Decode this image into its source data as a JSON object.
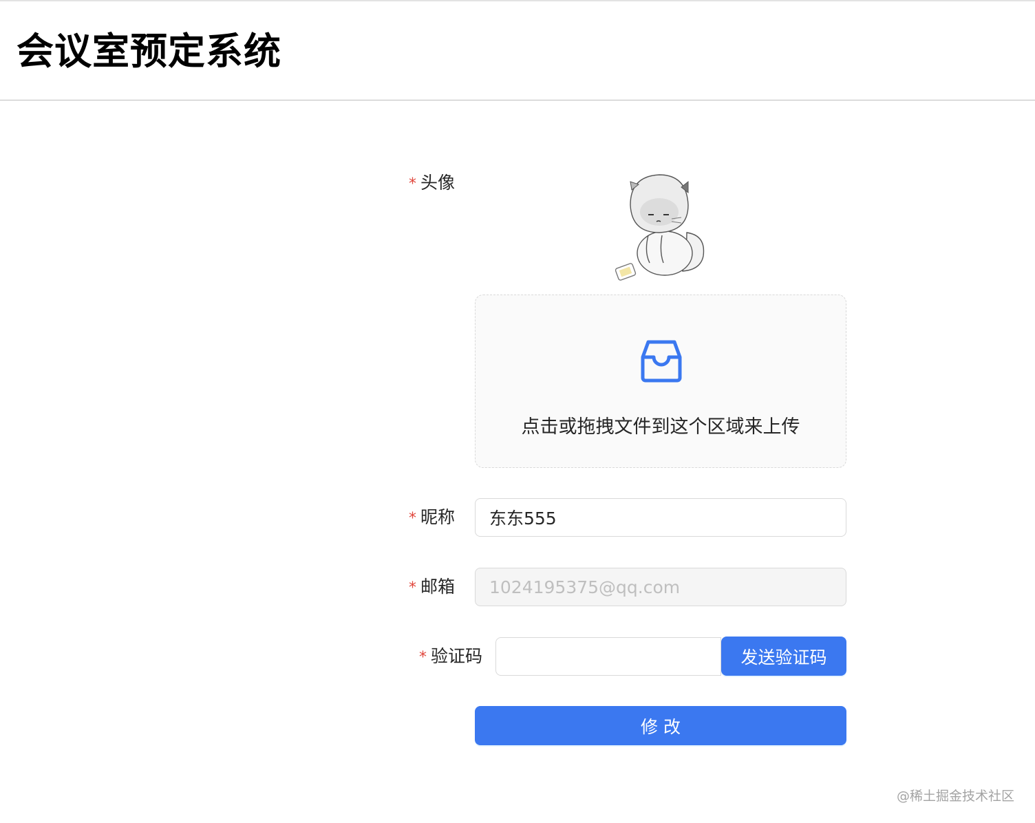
{
  "header": {
    "title": "会议室预定系统"
  },
  "form": {
    "avatar_label": "头像",
    "required_mark": "*",
    "upload_hint": "点击或拖拽文件到这个区域来上传",
    "nickname_label": "昵称",
    "nickname_value": "东东555",
    "email_label": "邮箱",
    "email_value": "1024195375@qq.com",
    "captcha_label": "验证码",
    "captcha_value": "",
    "send_captcha_label": "发送验证码",
    "submit_label": "修 改"
  },
  "icons": {
    "upload": "inbox-icon",
    "avatar": "cartoon-cat-avatar"
  },
  "colors": {
    "primary": "#3b78f0",
    "required": "#e0463c",
    "border": "#d9d9d9"
  },
  "watermark": "@稀土掘金技术社区"
}
